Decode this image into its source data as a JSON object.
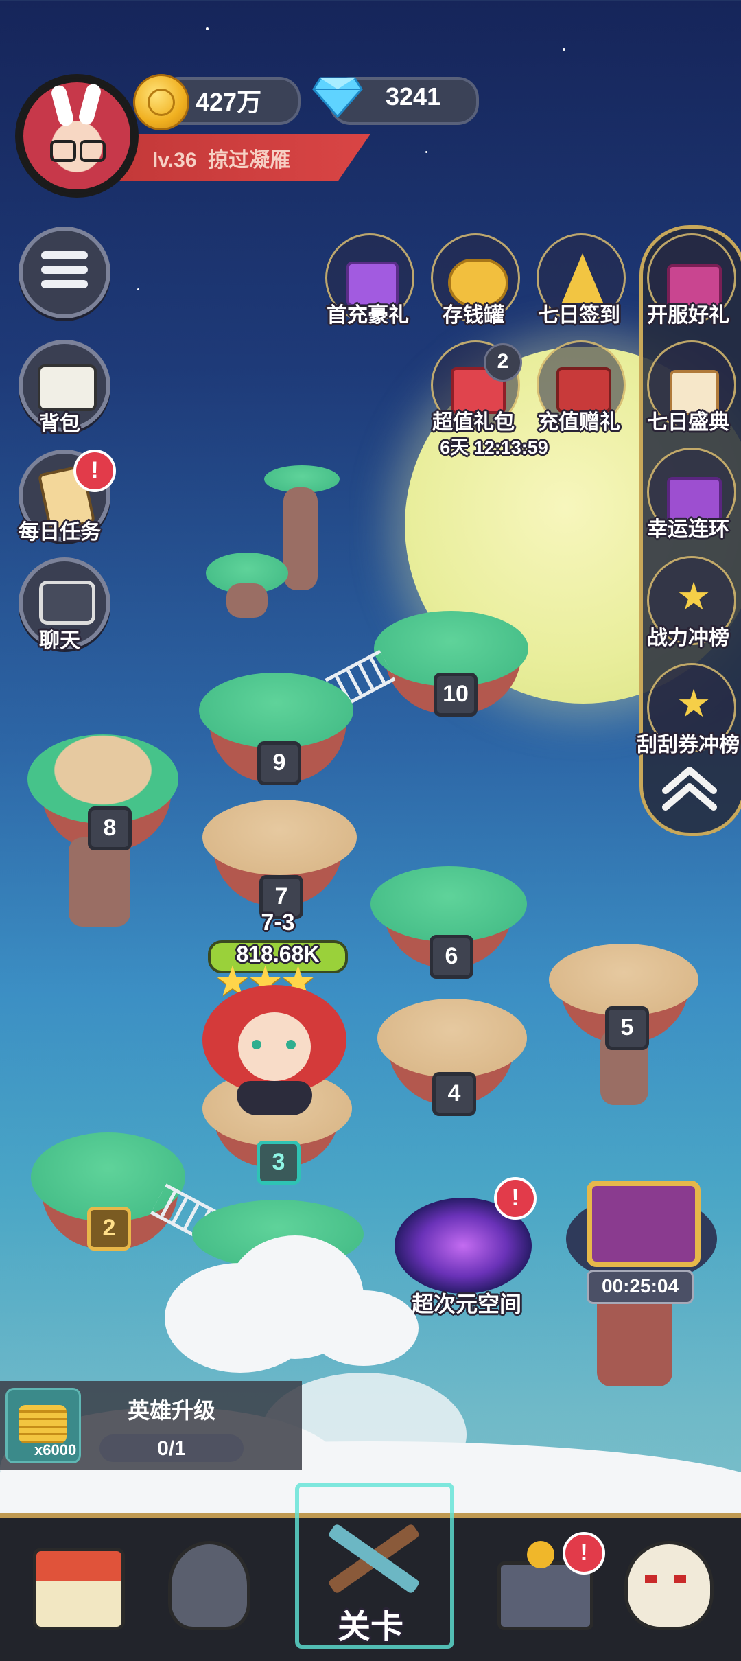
{
  "player": {
    "level_label": "lv.36",
    "name": "掠过凝雁",
    "coins": "427万",
    "gems": "3241"
  },
  "left_menu": {
    "bag": "背包",
    "daily_tasks": "每日任务",
    "chat": "聊天"
  },
  "events_row1": [
    "首充豪礼",
    "存钱罐",
    "七日签到"
  ],
  "events_row2": {
    "value_pack": "超值礼包",
    "value_pack_count": "2",
    "value_pack_timer": "6天 12:13:59",
    "recharge_gift": "充值赠礼"
  },
  "right_panel": [
    "开服好礼",
    "七日盛典",
    "幸运连环",
    "战力冲榜",
    "刮刮券冲榜"
  ],
  "stages": {
    "current_stage": "7-3",
    "power": "818.68K",
    "labels": [
      "2",
      "3",
      "4",
      "5",
      "6",
      "7",
      "8",
      "9",
      "10"
    ]
  },
  "portal": {
    "label": "超次元空间",
    "alert": "!"
  },
  "chest": {
    "timer": "00:25:04"
  },
  "task": {
    "title": "英雄升级",
    "reward": "x6000",
    "progress": "0/1",
    "progress_value": 0
  },
  "bottom_nav": {
    "active_label": "关卡"
  },
  "colors": {
    "sky_top": "#16255a",
    "moon": "#e9ee9c",
    "badge_red": "#e23b4a",
    "power_bar": "#9ad13a"
  }
}
